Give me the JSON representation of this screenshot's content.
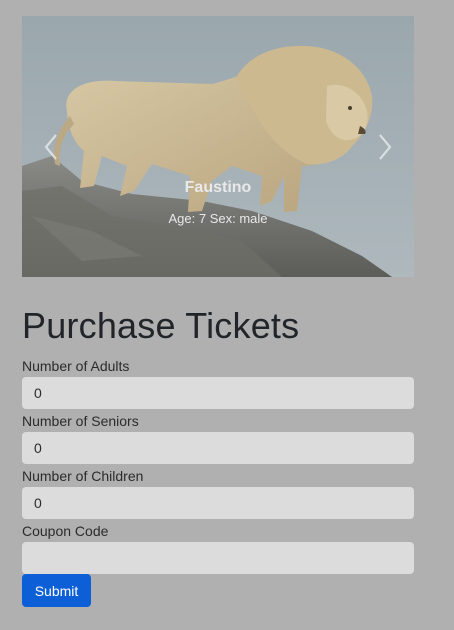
{
  "carousel": {
    "animal_name": "Faustino",
    "animal_details": "Age: 7 Sex: male",
    "prev_icon": "chevron-left-icon",
    "next_icon": "chevron-right-icon"
  },
  "form": {
    "title": "Purchase Tickets",
    "fields": [
      {
        "label": "Number of Adults",
        "value": "0"
      },
      {
        "label": "Number of Seniors",
        "value": "0"
      },
      {
        "label": "Number of Children",
        "value": "0"
      },
      {
        "label": "Coupon Code",
        "value": ""
      }
    ],
    "submit_label": "Submit"
  },
  "colors": {
    "background": "#b0b0b0",
    "input_background": "#dcdcdc",
    "submit_button": "#0d5fd8"
  }
}
